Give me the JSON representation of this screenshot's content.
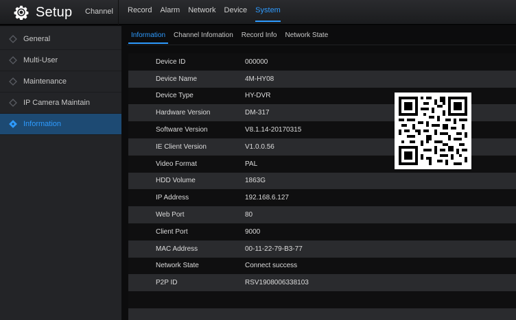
{
  "header": {
    "title": "Setup",
    "brand_channel": "Channel",
    "tabs": [
      {
        "label": "Record"
      },
      {
        "label": "Alarm"
      },
      {
        "label": "Network"
      },
      {
        "label": "Device"
      },
      {
        "label": "System",
        "active": true
      }
    ]
  },
  "sidebar": {
    "items": [
      {
        "label": "General"
      },
      {
        "label": "Multi-User"
      },
      {
        "label": "Maintenance"
      },
      {
        "label": "IP Camera Maintain"
      },
      {
        "label": "Information",
        "active": true
      }
    ]
  },
  "subtabs": [
    {
      "label": "Information",
      "active": true
    },
    {
      "label": "Channel Infomation"
    },
    {
      "label": "Record Info"
    },
    {
      "label": "Network State"
    }
  ],
  "info": {
    "rows": [
      {
        "label": "Device ID",
        "value": "000000"
      },
      {
        "label": "Device Name",
        "value": "4M-HY08"
      },
      {
        "label": "Device Type",
        "value": "HY-DVR"
      },
      {
        "label": "Hardware Version",
        "value": "DM-317"
      },
      {
        "label": "Software Version",
        "value": "V8.1.14-20170315"
      },
      {
        "label": "IE Client Version",
        "value": "V1.0.0.56"
      },
      {
        "label": "Video Format",
        "value": "PAL"
      },
      {
        "label": "HDD Volume",
        "value": "1863G"
      },
      {
        "label": "IP Address",
        "value": "192.168.6.127"
      },
      {
        "label": "Web Port",
        "value": "80"
      },
      {
        "label": "Client Port",
        "value": "9000"
      },
      {
        "label": "MAC Address",
        "value": "00-11-22-79-B3-77"
      },
      {
        "label": "Network State",
        "value": "Connect success"
      },
      {
        "label": "P2P ID",
        "value": "RSV1908006338103"
      },
      {
        "label": "",
        "value": ""
      },
      {
        "label": "",
        "value": ""
      }
    ]
  },
  "colors": {
    "accent": "#2e9bff",
    "sidebar_active": "#1d4a73"
  },
  "icons": {
    "brand": "gear-icon",
    "sidebar_bullet": "diamond-icon",
    "qr": "qr-code"
  }
}
